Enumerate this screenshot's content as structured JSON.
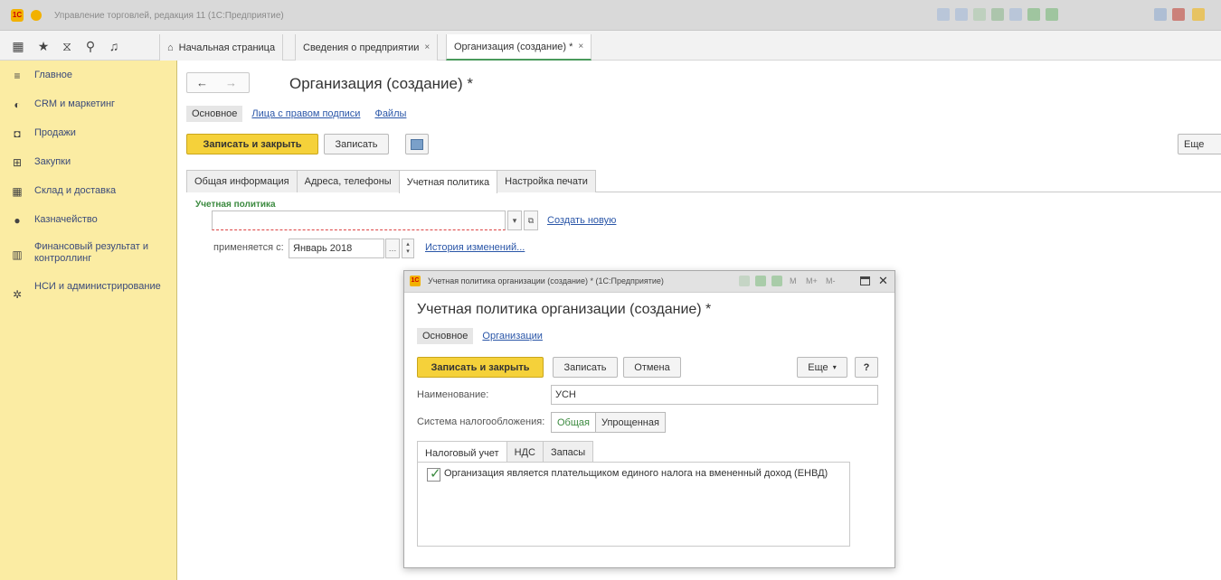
{
  "window": {
    "title": "Управление торговлей, редакция 11 (1С:Предприятие)",
    "logo_text": "1С"
  },
  "tabs": [
    {
      "label": "Начальная страница"
    },
    {
      "label": "Сведения о предприятии",
      "close": "×"
    },
    {
      "label": "Организация (создание) *",
      "close": "×"
    }
  ],
  "sidebar": {
    "items": [
      {
        "icon": "menu-icon",
        "label": "Главное"
      },
      {
        "icon": "crm-icon",
        "label": "CRM и маркетинг"
      },
      {
        "icon": "bag-icon",
        "label": "Продажи"
      },
      {
        "icon": "cart-icon",
        "label": "Закупки"
      },
      {
        "icon": "warehouse-icon",
        "label": "Склад и доставка"
      },
      {
        "icon": "treasury-icon",
        "label": "Казначейство"
      },
      {
        "icon": "chart-icon",
        "label": "Финансовый результат и контроллинг"
      },
      {
        "icon": "gear-icon",
        "label": "НСИ и администрирование"
      }
    ]
  },
  "form": {
    "title": "Организация (создание) *",
    "sections": [
      "Основное",
      "Лица с правом подписи",
      "Файлы"
    ],
    "buttons": {
      "save_close": "Записать и закрыть",
      "save": "Записать",
      "more": "Еще"
    },
    "tabs": [
      "Общая информация",
      "Адреса, телефоны",
      "Учетная политика",
      "Настройка печати"
    ],
    "policy": {
      "group_label": "Учетная политика",
      "value": "",
      "create_link": "Создать новую",
      "applies_label": "применяется с:",
      "applies_value": "Январь 2018",
      "history_link": "История изменений..."
    }
  },
  "dialog": {
    "window_title": "Учетная политика организации (создание) * (1С:Предприятие)",
    "title": "Учетная политика организации (создание) *",
    "sections": [
      "Основное",
      "Организации"
    ],
    "buttons": {
      "save_close": "Записать и закрыть",
      "save": "Записать",
      "cancel": "Отмена",
      "more": "Еще",
      "help": "?"
    },
    "head_controls": [
      "M",
      "M+",
      "M-"
    ],
    "name_label": "Наименование:",
    "name_value": "УСН",
    "tax_label": "Система налогообложения:",
    "tax_options": [
      "Общая",
      "Упрощенная"
    ],
    "tax_selected": "Общая",
    "inner_tabs": [
      "Налоговый учет",
      "НДС",
      "Запасы"
    ],
    "checkbox_label": "Организация является плательщиком единого налога на вмененный доход (ЕНВД)",
    "checkbox_checked": true
  },
  "colors": {
    "sidebar_bg": "#fbeca3",
    "primary_button": "#f5d13a",
    "link": "#2a56a8",
    "accent_green": "#3b8a3f"
  }
}
